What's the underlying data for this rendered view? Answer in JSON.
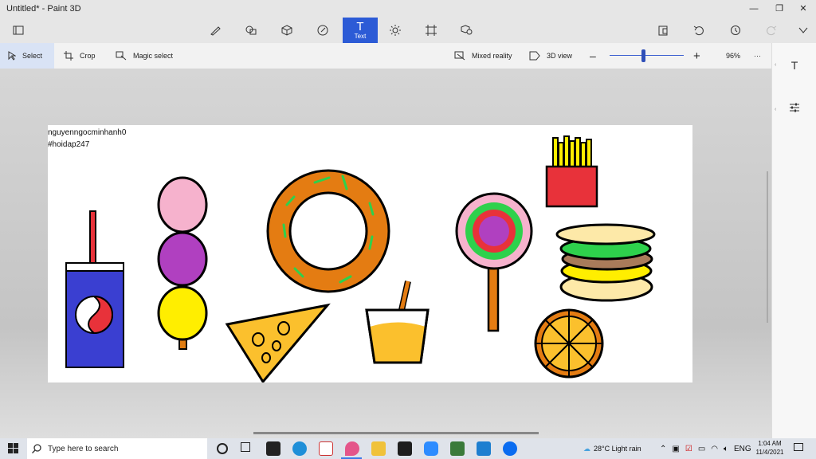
{
  "window": {
    "title": "Untitled* - Paint 3D"
  },
  "toolbar": {
    "tools": [
      {
        "name": "brushes-icon"
      },
      {
        "name": "2d-shapes-icon"
      },
      {
        "name": "3d-shapes-icon"
      },
      {
        "name": "stickers-icon"
      },
      {
        "name": "text-icon",
        "label": "Text",
        "active": true
      },
      {
        "name": "effects-icon"
      },
      {
        "name": "canvas-icon"
      },
      {
        "name": "3d-library-icon"
      }
    ]
  },
  "subbar": {
    "select": "Select",
    "crop": "Crop",
    "magic_select": "Magic select",
    "mixed_reality": "Mixed reality",
    "view_3d": "3D view",
    "zoom": "96%",
    "zoom_level": 0.46,
    "more": "···"
  },
  "canvas": {
    "line1": "nguyenngocminhanh0",
    "line2": "#hoidap247"
  },
  "taskbar": {
    "search_placeholder": "Type here to search",
    "weather": "28°C  Light rain",
    "lang": "ENG",
    "time": "1:04 AM",
    "date": "11/4/2021"
  },
  "colors": {
    "accent": "#2c5bd6"
  }
}
